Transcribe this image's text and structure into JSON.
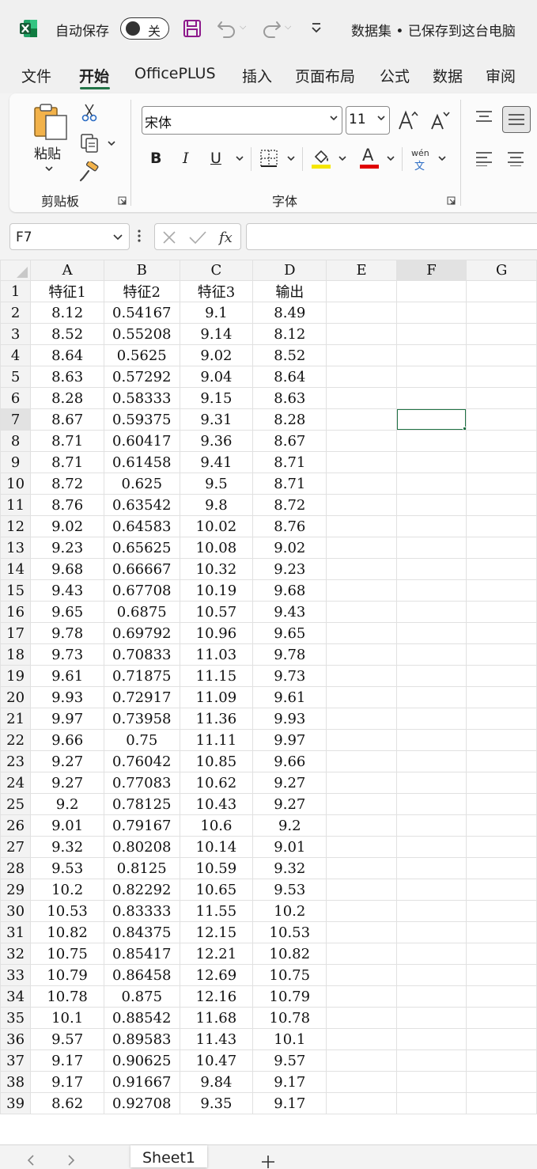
{
  "titlebar": {
    "autosave_label": "自动保存",
    "autosave_state": "关",
    "doc_title": "数据集 • 已保存到这台电脑"
  },
  "menu_tabs": [
    "文件",
    "开始",
    "OfficePLUS",
    "插入",
    "页面布局",
    "公式",
    "数据",
    "审阅"
  ],
  "active_tab": "开始",
  "ribbon": {
    "clipboard": {
      "paste_label": "粘贴",
      "group_label": "剪贴板"
    },
    "font": {
      "font_name": "宋体",
      "font_size": "11",
      "bold": "B",
      "italic": "I",
      "underline": "U",
      "font_color_glyph": "A",
      "phonetic_top": "wén",
      "phonetic_bottom": "文",
      "group_label": "字体"
    },
    "colors": {
      "highlight": "#f5e600",
      "font_color": "#e00000"
    }
  },
  "formula_bar": {
    "name_box": "F7",
    "formula": ""
  },
  "grid": {
    "columns": [
      "A",
      "B",
      "C",
      "D",
      "E",
      "F",
      "G"
    ],
    "selected_column": "F",
    "selected_row": 7,
    "active_cell": "F7",
    "row_numbers": [
      1,
      2,
      3,
      4,
      5,
      6,
      7,
      8,
      9,
      10,
      11,
      12,
      13,
      14,
      15,
      16,
      17,
      18,
      19,
      20,
      21,
      22,
      23,
      24,
      25,
      26,
      27,
      28,
      29,
      30,
      31,
      32,
      33,
      34,
      35,
      36,
      37,
      38,
      39
    ],
    "rows": [
      [
        "特征1",
        "特征2",
        "特征3",
        "输出"
      ],
      [
        "8.12",
        "0.54167",
        "9.1",
        "8.49"
      ],
      [
        "8.52",
        "0.55208",
        "9.14",
        "8.12"
      ],
      [
        "8.64",
        "0.5625",
        "9.02",
        "8.52"
      ],
      [
        "8.63",
        "0.57292",
        "9.04",
        "8.64"
      ],
      [
        "8.28",
        "0.58333",
        "9.15",
        "8.63"
      ],
      [
        "8.67",
        "0.59375",
        "9.31",
        "8.28"
      ],
      [
        "8.71",
        "0.60417",
        "9.36",
        "8.67"
      ],
      [
        "8.71",
        "0.61458",
        "9.41",
        "8.71"
      ],
      [
        "8.72",
        "0.625",
        "9.5",
        "8.71"
      ],
      [
        "8.76",
        "0.63542",
        "9.8",
        "8.72"
      ],
      [
        "9.02",
        "0.64583",
        "10.02",
        "8.76"
      ],
      [
        "9.23",
        "0.65625",
        "10.08",
        "9.02"
      ],
      [
        "9.68",
        "0.66667",
        "10.32",
        "9.23"
      ],
      [
        "9.43",
        "0.67708",
        "10.19",
        "9.68"
      ],
      [
        "9.65",
        "0.6875",
        "10.57",
        "9.43"
      ],
      [
        "9.78",
        "0.69792",
        "10.96",
        "9.65"
      ],
      [
        "9.73",
        "0.70833",
        "11.03",
        "9.78"
      ],
      [
        "9.61",
        "0.71875",
        "11.15",
        "9.73"
      ],
      [
        "9.93",
        "0.72917",
        "11.09",
        "9.61"
      ],
      [
        "9.97",
        "0.73958",
        "11.36",
        "9.93"
      ],
      [
        "9.66",
        "0.75",
        "11.11",
        "9.97"
      ],
      [
        "9.27",
        "0.76042",
        "10.85",
        "9.66"
      ],
      [
        "9.27",
        "0.77083",
        "10.62",
        "9.27"
      ],
      [
        "9.2",
        "0.78125",
        "10.43",
        "9.27"
      ],
      [
        "9.01",
        "0.79167",
        "10.6",
        "9.2"
      ],
      [
        "9.32",
        "0.80208",
        "10.14",
        "9.01"
      ],
      [
        "9.53",
        "0.8125",
        "10.59",
        "9.32"
      ],
      [
        "10.2",
        "0.82292",
        "10.65",
        "9.53"
      ],
      [
        "10.53",
        "0.83333",
        "11.55",
        "10.2"
      ],
      [
        "10.82",
        "0.84375",
        "12.15",
        "10.53"
      ],
      [
        "10.75",
        "0.85417",
        "12.21",
        "10.82"
      ],
      [
        "10.79",
        "0.86458",
        "12.69",
        "10.75"
      ],
      [
        "10.78",
        "0.875",
        "12.16",
        "10.79"
      ],
      [
        "10.1",
        "0.88542",
        "11.68",
        "10.78"
      ],
      [
        "9.57",
        "0.89583",
        "11.43",
        "10.1"
      ],
      [
        "9.17",
        "0.90625",
        "10.47",
        "9.57"
      ],
      [
        "9.17",
        "0.91667",
        "9.84",
        "9.17"
      ],
      [
        "8.62",
        "0.92708",
        "9.35",
        "9.17"
      ]
    ]
  },
  "sheet_tabs": {
    "active": "Sheet1"
  }
}
